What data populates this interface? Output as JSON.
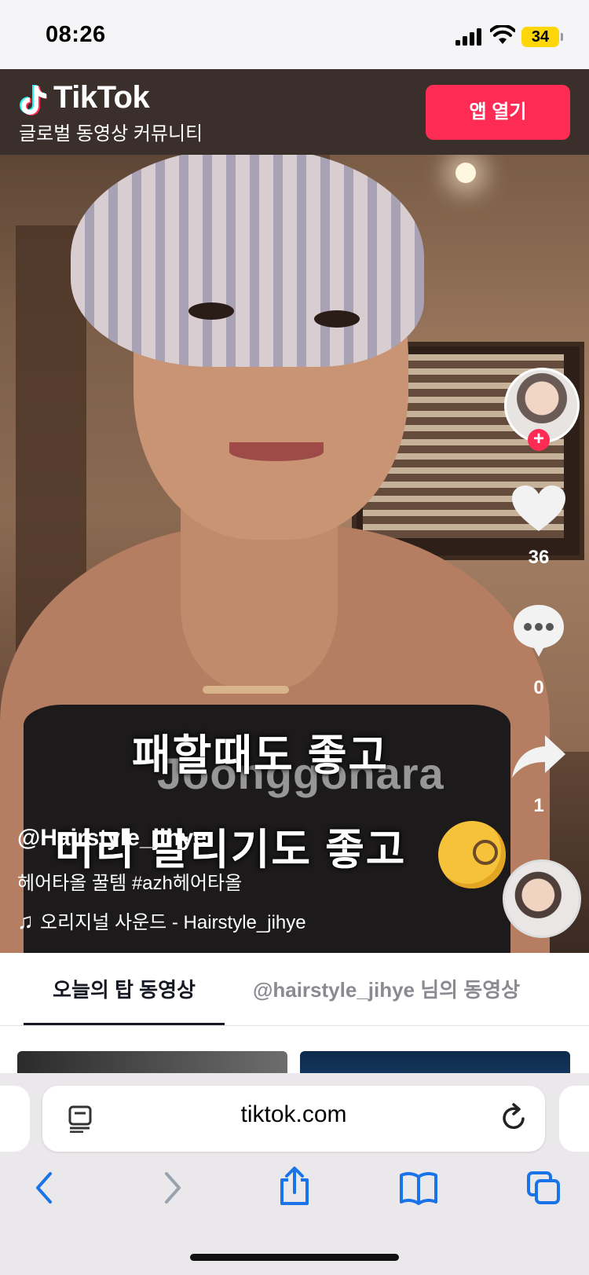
{
  "status": {
    "time": "08:26",
    "battery": "34"
  },
  "banner": {
    "brand": "TikTok",
    "subtitle": "글로벌 동영상 커뮤니티",
    "open_app_label": "앱 열기"
  },
  "video": {
    "watermark": "Joonggonara",
    "caption_line1": "패할때도 좋고",
    "caption_line2": "머리 말리기도 좋고",
    "username": "@Hairstyle_jihye",
    "description": "헤어타올 꿀템 #azh헤어타올",
    "sound": "오리지널 사운드 - Hairstyle_jihye",
    "likes": "36",
    "comments": "0",
    "shares": "1"
  },
  "tabs": {
    "active": "오늘의 탑 동영상",
    "inactive": "@hairstyle_jihye 님의 동영상"
  },
  "browser": {
    "url": "tiktok.com"
  },
  "colors": {
    "accent": "#fe2c55",
    "banner_bg": "#3a2f2b",
    "battery": "#ffd60a",
    "safari_blue": "#1a73e8"
  }
}
